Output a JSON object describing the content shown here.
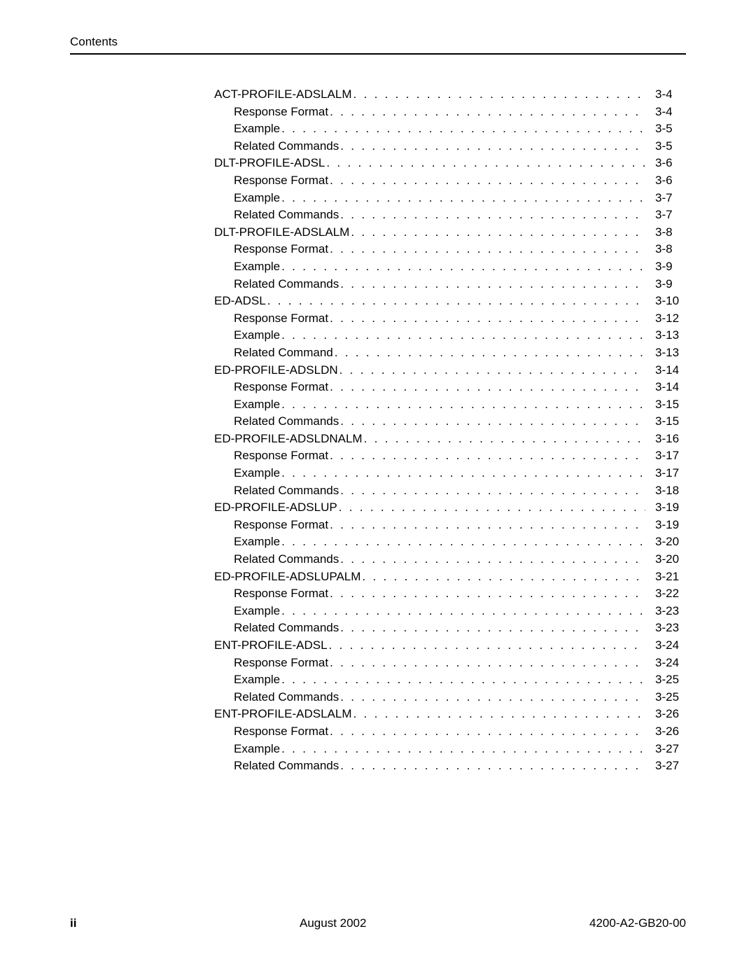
{
  "header": {
    "label": "Contents"
  },
  "toc": {
    "entries": [
      {
        "level": 1,
        "label": "ACT-PROFILE-ADSLALM",
        "page": "3-4"
      },
      {
        "level": 2,
        "label": "Response Format",
        "page": "3-4"
      },
      {
        "level": 2,
        "label": "Example",
        "page": "3-5"
      },
      {
        "level": 2,
        "label": "Related Commands",
        "page": "3-5"
      },
      {
        "level": 1,
        "label": "DLT-PROFILE-ADSL",
        "page": "3-6"
      },
      {
        "level": 2,
        "label": "Response Format",
        "page": "3-6"
      },
      {
        "level": 2,
        "label": "Example",
        "page": "3-7"
      },
      {
        "level": 2,
        "label": "Related Commands",
        "page": "3-7"
      },
      {
        "level": 1,
        "label": "DLT-PROFILE-ADSLALM",
        "page": "3-8"
      },
      {
        "level": 2,
        "label": "Response Format",
        "page": "3-8"
      },
      {
        "level": 2,
        "label": "Example",
        "page": "3-9"
      },
      {
        "level": 2,
        "label": "Related Commands",
        "page": "3-9"
      },
      {
        "level": 1,
        "label": "ED-ADSL",
        "page": "3-10"
      },
      {
        "level": 2,
        "label": "Response Format",
        "page": "3-12"
      },
      {
        "level": 2,
        "label": "Example",
        "page": "3-13"
      },
      {
        "level": 2,
        "label": "Related Command",
        "page": "3-13"
      },
      {
        "level": 1,
        "label": "ED-PROFILE-ADSLDN",
        "page": "3-14"
      },
      {
        "level": 2,
        "label": "Response Format",
        "page": "3-14"
      },
      {
        "level": 2,
        "label": "Example",
        "page": "3-15"
      },
      {
        "level": 2,
        "label": "Related Commands",
        "page": "3-15"
      },
      {
        "level": 1,
        "label": "ED-PROFILE-ADSLDNALM",
        "page": "3-16"
      },
      {
        "level": 2,
        "label": "Response Format",
        "page": "3-17"
      },
      {
        "level": 2,
        "label": "Example",
        "page": "3-17"
      },
      {
        "level": 2,
        "label": "Related Commands",
        "page": "3-18"
      },
      {
        "level": 1,
        "label": "ED-PROFILE-ADSLUP",
        "page": "3-19"
      },
      {
        "level": 2,
        "label": "Response Format",
        "page": "3-19"
      },
      {
        "level": 2,
        "label": "Example",
        "page": "3-20"
      },
      {
        "level": 2,
        "label": "Related Commands",
        "page": "3-20"
      },
      {
        "level": 1,
        "label": "ED-PROFILE-ADSLUPALM",
        "page": "3-21"
      },
      {
        "level": 2,
        "label": "Response Format",
        "page": "3-22"
      },
      {
        "level": 2,
        "label": "Example",
        "page": "3-23"
      },
      {
        "level": 2,
        "label": "Related Commands",
        "page": "3-23"
      },
      {
        "level": 1,
        "label": "ENT-PROFILE-ADSL",
        "page": "3-24"
      },
      {
        "level": 2,
        "label": "Response Format",
        "page": "3-24"
      },
      {
        "level": 2,
        "label": "Example",
        "page": "3-25"
      },
      {
        "level": 2,
        "label": "Related Commands",
        "page": "3-25"
      },
      {
        "level": 1,
        "label": "ENT-PROFILE-ADSLALM",
        "page": "3-26"
      },
      {
        "level": 2,
        "label": "Response Format",
        "page": "3-26"
      },
      {
        "level": 2,
        "label": "Example",
        "page": "3-27"
      },
      {
        "level": 2,
        "label": "Related Commands",
        "page": "3-27"
      }
    ]
  },
  "footer": {
    "page_number": "ii",
    "center": "August 2002",
    "right": "4200-A2-GB20-00"
  }
}
